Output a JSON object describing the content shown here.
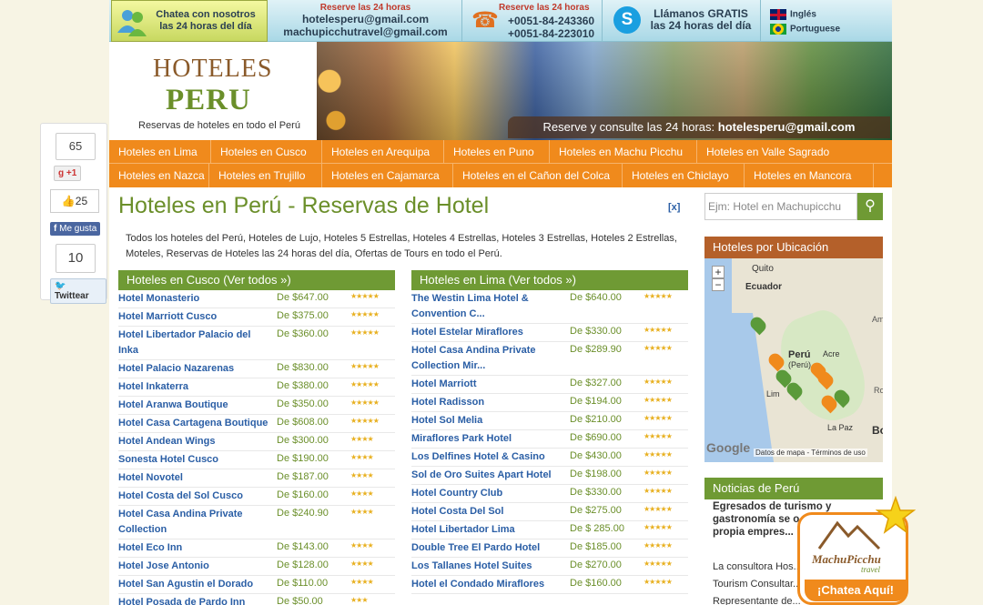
{
  "social": {
    "gplus_count": "65",
    "gplus_label": "+1",
    "fb_count": "25",
    "fb_label": "Me gusta",
    "tw_count": "10",
    "tw_label": "Twittear"
  },
  "topbar": {
    "chat_line1": "Chatea con nosotros",
    "chat_line2": "las 24 horas del día",
    "email_title": "Reserve las 24 horas",
    "email1": "hotelesperu@gmail.com",
    "email2": "machupicchutravel@gmail.com",
    "phone_title": "Reserve las 24 horas",
    "phone1": "+0051-84-243360",
    "phone2": "+0051-84-223010",
    "skype_line1": "Llámanos GRATIS",
    "skype_line2": "las 24 horas del día",
    "lang1": "Inglés",
    "lang2": "Portuguese"
  },
  "logo": {
    "line1": "HOTELES",
    "line2": "PERU",
    "tagline": "Reservas de hoteles en todo el Perú"
  },
  "banner": {
    "reserve_text": "Reserve y consulte las 24 horas:",
    "reserve_email": "hotelesperu@gmail.com"
  },
  "nav": {
    "row1": [
      "Hoteles en Lima",
      "Hoteles en Cusco",
      "Hoteles en Arequipa",
      "Hoteles en Puno",
      "Hoteles en Machu Picchu",
      "Hoteles en Valle Sagrado"
    ],
    "row2": [
      "Hoteles en Nazca",
      "Hoteles en Trujillo",
      "Hoteles en Cajamarca",
      "Hoteles en el Cañon del Colca",
      "Hoteles en Chiclayo",
      "Hoteles en Mancora"
    ]
  },
  "main": {
    "title": "Hoteles en Perú - Reservas de Hotel",
    "close": "[x]",
    "intro": "Todos los hoteles del Perú, Hoteles de Lujo, Hoteles 5 Estrellas, Hoteles 4 Estrellas, Hoteles 3 Estrellas, Hoteles 2 Estrellas, Moteles, Reservas de Hoteles las 24 horas del día, Ofertas de Tours en todo el Perú."
  },
  "cusco": {
    "header": "Hoteles en Cusco (Ver todos »)",
    "hotels": [
      {
        "name": "Hotel Monasterio",
        "price": "De $647.00",
        "stars": 5
      },
      {
        "name": "Hotel Marriott Cusco",
        "price": "De $375.00",
        "stars": 5
      },
      {
        "name": "Hotel Libertador Palacio del Inka",
        "price": "De $360.00",
        "stars": 5
      },
      {
        "name": "Hotel Palacio Nazarenas",
        "price": "De $830.00",
        "stars": 5
      },
      {
        "name": "Hotel Inkaterra",
        "price": "De $380.00",
        "stars": 5
      },
      {
        "name": "Hotel Aranwa Boutique",
        "price": "De $350.00",
        "stars": 5
      },
      {
        "name": "Hotel Casa Cartagena Boutique",
        "price": "De $608.00",
        "stars": 5
      },
      {
        "name": "Hotel Andean Wings",
        "price": "De $300.00",
        "stars": 4
      },
      {
        "name": "Sonesta Hotel Cusco",
        "price": "De $190.00",
        "stars": 4
      },
      {
        "name": "Hotel Novotel",
        "price": "De $187.00",
        "stars": 4
      },
      {
        "name": "Hotel Costa del Sol Cusco",
        "price": "De $160.00",
        "stars": 4
      },
      {
        "name": "Hotel Casa Andina Private Collection",
        "price": "De $240.90",
        "stars": 4
      },
      {
        "name": "Hotel Eco Inn",
        "price": "De $143.00",
        "stars": 4
      },
      {
        "name": "Hotel Jose Antonio",
        "price": "De $128.00",
        "stars": 4
      },
      {
        "name": "Hotel San Agustin el Dorado",
        "price": "De $110.00",
        "stars": 4
      },
      {
        "name": "Hotel Posada de Pardo Inn",
        "price": "De $50.00",
        "stars": 3
      }
    ]
  },
  "lima": {
    "header": "Hoteles en Lima (Ver todos »)",
    "hotels": [
      {
        "name": "The Westin Lima Hotel & Convention C...",
        "price": "De $640.00",
        "stars": 5
      },
      {
        "name": "Hotel Estelar Miraflores",
        "price": "De $330.00",
        "stars": 5
      },
      {
        "name": "Hotel Casa Andina Private Collection Mir...",
        "price": "De $289.90",
        "stars": 5
      },
      {
        "name": "Hotel Marriott",
        "price": "De $327.00",
        "stars": 5
      },
      {
        "name": "Hotel Radisson",
        "price": "De $194.00",
        "stars": 5
      },
      {
        "name": "Hotel Sol Melia",
        "price": "De $210.00",
        "stars": 5
      },
      {
        "name": "Miraflores Park Hotel",
        "price": "De $690.00",
        "stars": 5
      },
      {
        "name": "Los Delfines Hotel & Casino",
        "price": "De $430.00",
        "stars": 5
      },
      {
        "name": "Sol de Oro Suites Apart Hotel",
        "price": "De $198.00",
        "stars": 5
      },
      {
        "name": "Hotel Country Club",
        "price": "De $330.00",
        "stars": 5
      },
      {
        "name": "Hotel Costa Del Sol",
        "price": "De $275.00",
        "stars": 5
      },
      {
        "name": "Hotel Libertador Lima",
        "price": "De $ 285.00",
        "stars": 5
      },
      {
        "name": "Double Tree El Pardo Hotel",
        "price": "De $185.00",
        "stars": 5
      },
      {
        "name": "Los Tallanes Hotel Suites",
        "price": "De $270.00",
        "stars": 5
      },
      {
        "name": "Hotel el Condado Miraflores",
        "price": "De $160.00",
        "stars": 5
      }
    ]
  },
  "side": {
    "search_placeholder": "Ejm: Hotel en Machupicchu",
    "map_title": "Hoteles por Ubicación",
    "map_labels": {
      "quito": "Quito",
      "ecuador": "Ecuador",
      "peru": "Perú",
      "peru2": "(Perú)",
      "acre": "Acre",
      "lima": "Lim",
      "lapaz": "La Paz",
      "bo": "Bo",
      "am": "Am",
      "ro": "Ro"
    },
    "map_footer": "Datos de mapa - Términos de uso",
    "google": "Google",
    "news_title": "Noticias de Perú",
    "news_headline": "Egresados de turismo y gastronomía se o... su propia empres...",
    "news_body": "La consultora Hos... Tourism Consultar... Representante de..."
  },
  "chat": {
    "brand": "MachuPicchu",
    "sub": "travel",
    "cta": "¡Chatea Aquí!"
  },
  "colors": {
    "nav": "#f08a1c",
    "green": "#6f9a34",
    "brown": "#b4602a",
    "link": "#2a5ea5"
  }
}
